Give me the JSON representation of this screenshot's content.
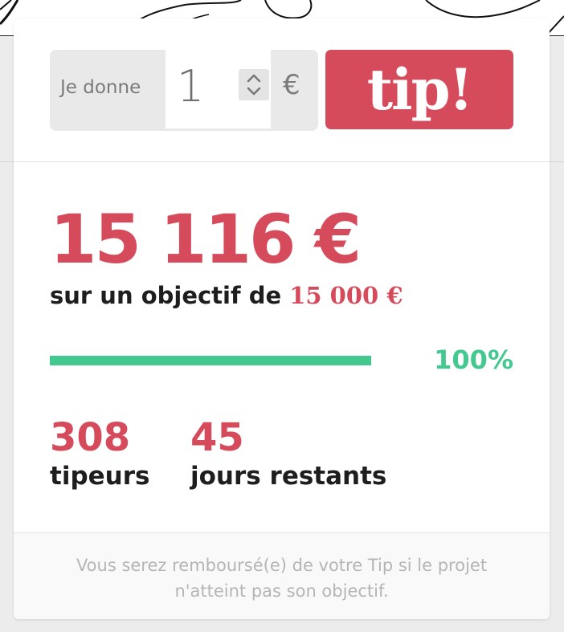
{
  "tip_form": {
    "give_label": "Je donne",
    "amount_value": "1",
    "currency_symbol": "€",
    "tip_button_label": "tip!"
  },
  "funding": {
    "amount_raised": "15 116 €",
    "goal_prefix": "sur un objectif de",
    "goal_amount": "15 000 €",
    "progress_percent": 100,
    "progress_label": "100%"
  },
  "stats": {
    "backers_value": "308",
    "backers_label": "tipeurs",
    "days_value": "45",
    "days_label": "jours restants"
  },
  "footer": {
    "refund_notice": "Vous serez remboursé(e) de votre Tip si le projet n'atteint pas son objectif."
  },
  "colors": {
    "accent_red": "#d64b5b",
    "progress_green": "#43c98f"
  },
  "icons": {
    "stepper": "chevron-up-down-icon"
  }
}
